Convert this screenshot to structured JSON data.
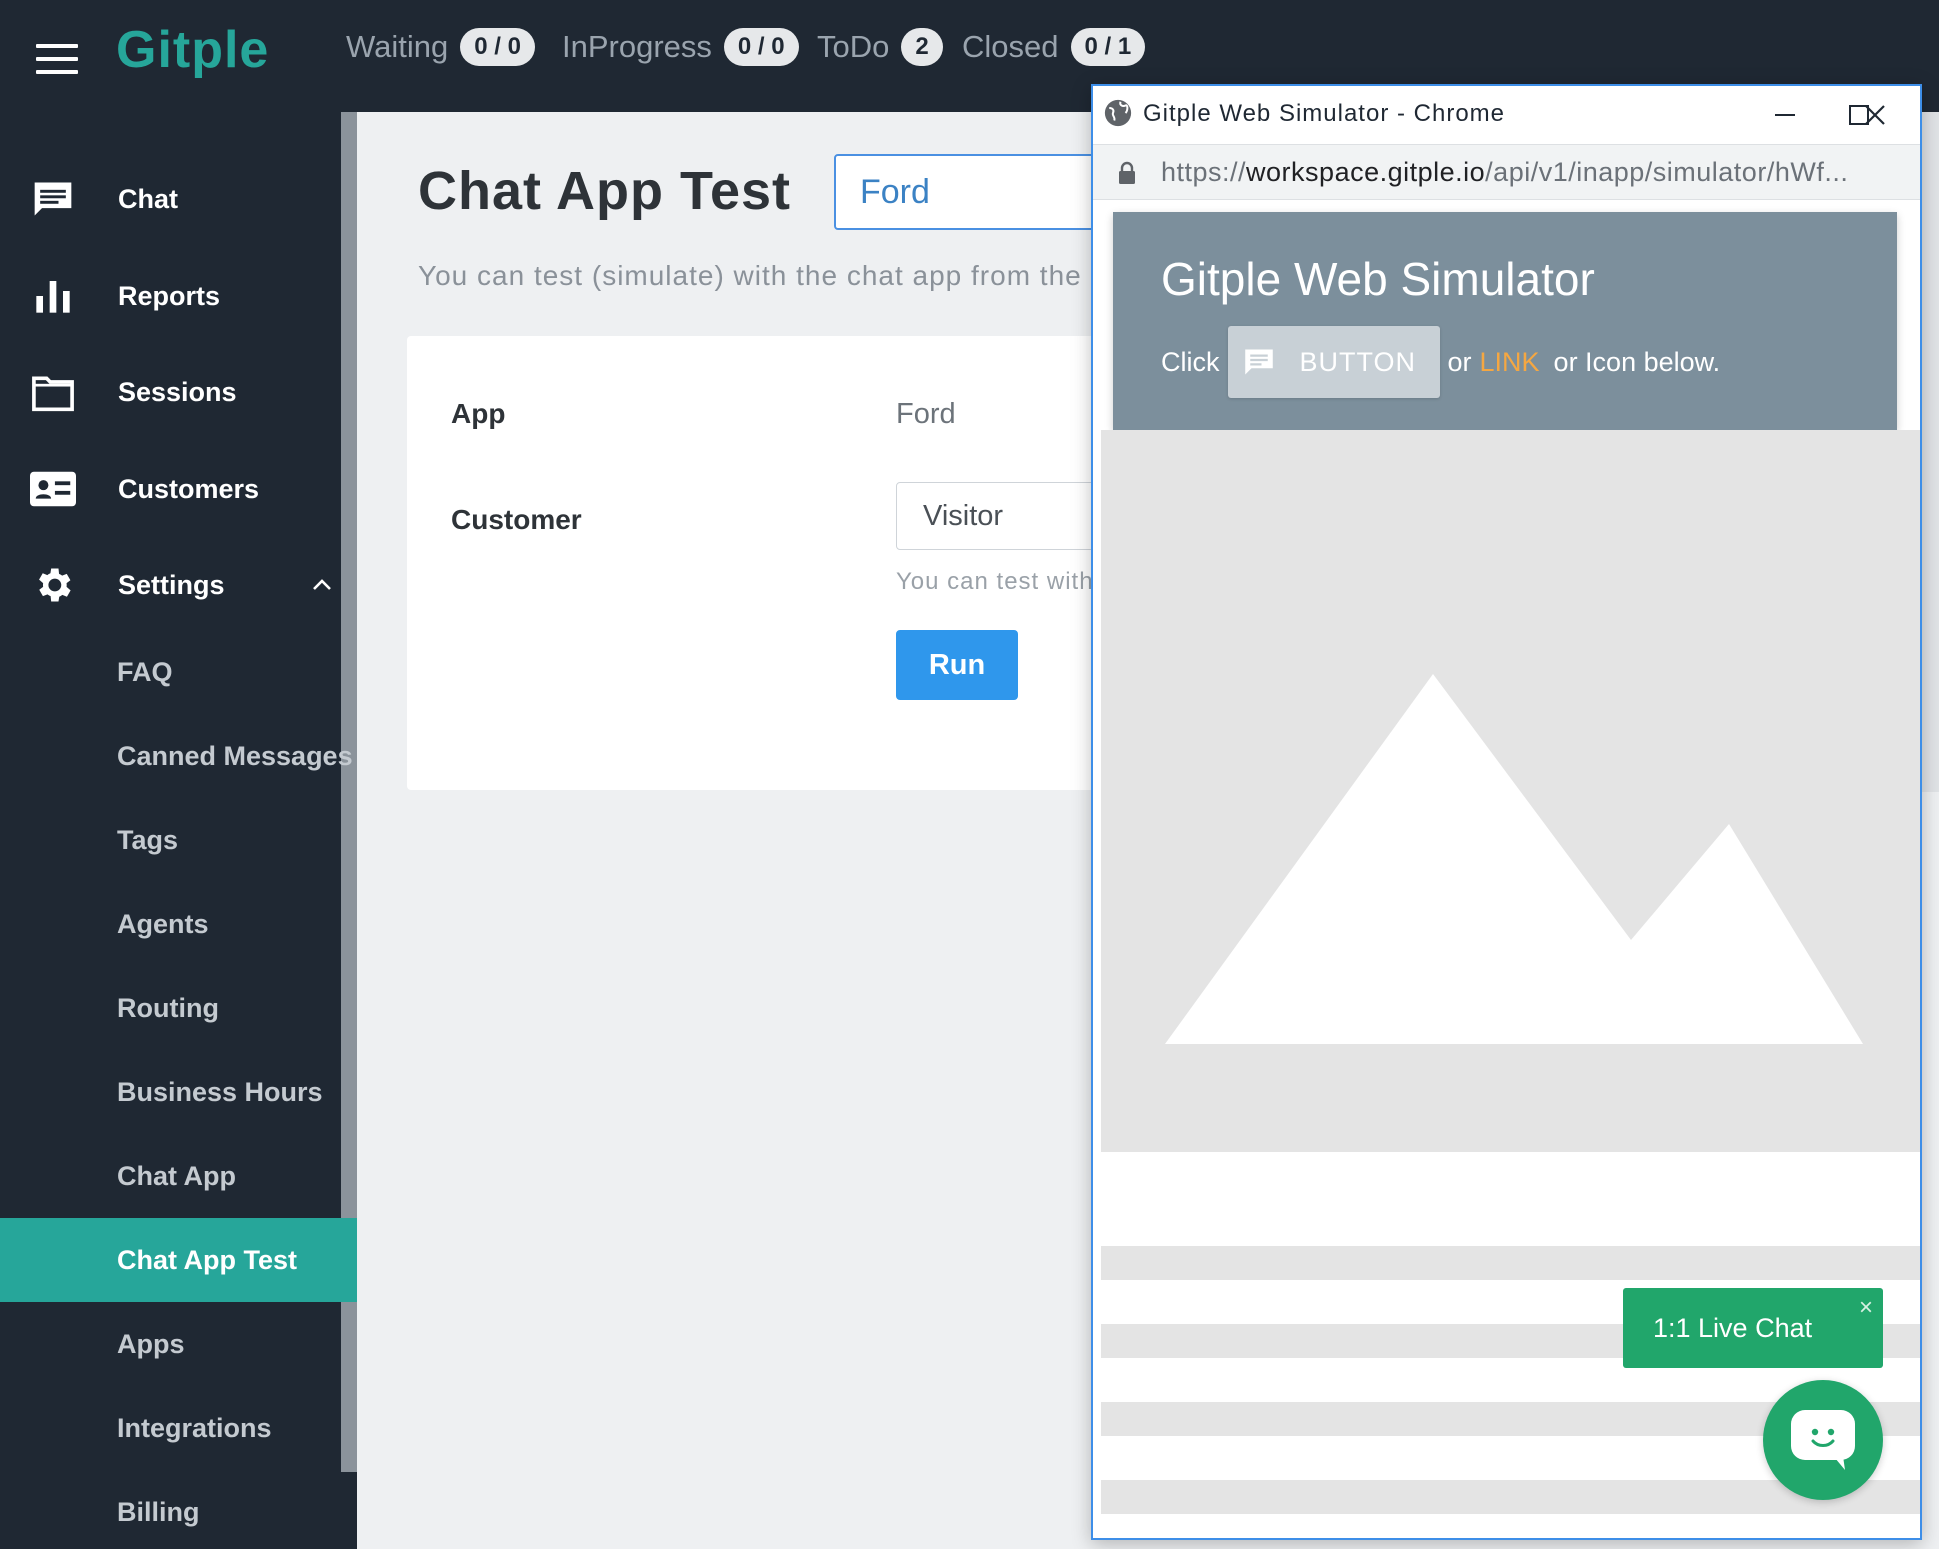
{
  "topbar": {
    "brand": "Gitple",
    "statuses": [
      {
        "label": "Waiting",
        "count": "0 / 0"
      },
      {
        "label": "InProgress",
        "count": "0 / 0"
      },
      {
        "label": "ToDo",
        "count": "2"
      },
      {
        "label": "Closed",
        "count": "0 / 1"
      }
    ]
  },
  "sidebar": {
    "items": [
      {
        "label": "Chat",
        "icon": "chat-icon"
      },
      {
        "label": "Reports",
        "icon": "bar-chart-icon"
      },
      {
        "label": "Sessions",
        "icon": "folder-icon"
      },
      {
        "label": "Customers",
        "icon": "id-card-icon"
      },
      {
        "label": "Settings",
        "icon": "gear-icon"
      }
    ],
    "settings_sub": [
      {
        "label": "FAQ"
      },
      {
        "label": "Canned Messages"
      },
      {
        "label": "Tags"
      },
      {
        "label": "Agents"
      },
      {
        "label": "Routing"
      },
      {
        "label": "Business Hours"
      },
      {
        "label": "Chat App"
      },
      {
        "label": "Chat App Test",
        "active": true
      },
      {
        "label": "Apps"
      },
      {
        "label": "Integrations"
      },
      {
        "label": "Billing"
      }
    ]
  },
  "main": {
    "title": "Chat App Test",
    "app_select_value": "Ford",
    "description": "You can test (simulate) with the chat app from the c",
    "form": {
      "app_label": "App",
      "app_value": "Ford",
      "customer_label": "Customer",
      "customer_value": "Visitor",
      "customer_help": "You can test with",
      "run_label": "Run"
    }
  },
  "popup": {
    "window_title": "Gitple Web Simulator - Chrome",
    "url_scheme": "https://",
    "url_host": "workspace.gitple.io",
    "url_path": "/api/v1/inapp/simulator/hWf...",
    "sim_title": "Gitple Web Simulator",
    "sim_click": "Click",
    "sim_button": "BUTTON",
    "sim_or": "or",
    "sim_link": "LINK",
    "sim_tail": "or Icon below.",
    "livechat_label": "1:1 Live Chat",
    "livechat_close": "×"
  },
  "colors": {
    "dark": "#1f2833",
    "accent": "#26a69a",
    "primary_button": "#2f97ec",
    "live_chat_green": "#21a66b",
    "link_orange": "#f5a742"
  }
}
